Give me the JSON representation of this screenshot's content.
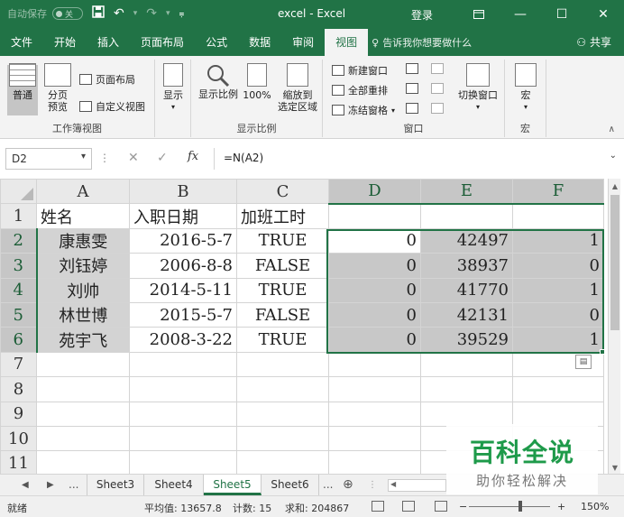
{
  "titlebar": {
    "autosave_label": "自动保存",
    "autosave_state": "关",
    "title": "excel  -  Excel",
    "login": "登录"
  },
  "ribbon_tabs": [
    {
      "label": "文件"
    },
    {
      "label": "开始"
    },
    {
      "label": "插入"
    },
    {
      "label": "页面布局"
    },
    {
      "label": "公式"
    },
    {
      "label": "数据"
    },
    {
      "label": "审阅"
    },
    {
      "label": "视图"
    }
  ],
  "active_tab": "视图",
  "tell_me": "告诉我你想要做什么",
  "share": "共享",
  "ribbon": {
    "workbook_views": {
      "label": "工作簿视图",
      "normal": "普通",
      "page_break": "分页\n预览",
      "page_layout": "页面布局",
      "custom_views": "自定义视图"
    },
    "show": {
      "label": "显示"
    },
    "zoom": {
      "label": "显示比例",
      "zoom": "显示比例",
      "hundred": "100%",
      "zoom_selection": "缩放到\n选定区域"
    },
    "window": {
      "label": "窗口",
      "new_window": "新建窗口",
      "arrange_all": "全部重排",
      "freeze_panes": "冻结窗格",
      "switch_windows": "切换窗口"
    },
    "macros": {
      "label": "宏",
      "macros": "宏"
    }
  },
  "formula_bar": {
    "name_box": "D2",
    "formula": "=N(A2)"
  },
  "columns": [
    "A",
    "B",
    "C",
    "D",
    "E",
    "F"
  ],
  "rows": [
    {
      "num": "1",
      "cells": [
        "姓名",
        "入职日期",
        "加班工时",
        "",
        "",
        ""
      ]
    },
    {
      "num": "2",
      "cells": [
        "康惠雯",
        "2016-5-7",
        "TRUE",
        "0",
        "42497",
        "1"
      ]
    },
    {
      "num": "3",
      "cells": [
        "刘钰婷",
        "2006-8-8",
        "FALSE",
        "0",
        "38937",
        "0"
      ]
    },
    {
      "num": "4",
      "cells": [
        "刘帅",
        "2014-5-11",
        "TRUE",
        "0",
        "41770",
        "1"
      ]
    },
    {
      "num": "5",
      "cells": [
        "林世博",
        "2015-5-7",
        "FALSE",
        "0",
        "42131",
        "0"
      ]
    },
    {
      "num": "6",
      "cells": [
        "苑宇飞",
        "2008-3-22",
        "TRUE",
        "0",
        "39529",
        "1"
      ]
    },
    {
      "num": "7",
      "cells": [
        "",
        "",
        "",
        "",
        "",
        ""
      ]
    },
    {
      "num": "8",
      "cells": [
        "",
        "",
        "",
        "",
        "",
        ""
      ]
    },
    {
      "num": "9",
      "cells": [
        "",
        "",
        "",
        "",
        "",
        ""
      ]
    },
    {
      "num": "10",
      "cells": [
        "",
        "",
        "",
        "",
        "",
        ""
      ]
    },
    {
      "num": "11",
      "cells": [
        "",
        "",
        "",
        "",
        "",
        ""
      ]
    }
  ],
  "sheet_tabs": [
    "Sheet3",
    "Sheet4",
    "Sheet5",
    "Sheet6"
  ],
  "active_sheet": "Sheet5",
  "sheet_more": "...",
  "status": {
    "ready": "就绪",
    "average": "平均值: 13657.8",
    "count": "计数: 15",
    "sum": "求和: 204867",
    "zoom": "150%"
  },
  "watermark": {
    "title": "百科全说",
    "subtitle": "助你轻松解决"
  },
  "colors": {
    "excel_green": "#217346",
    "watermark_green": "#1e9a4a"
  }
}
